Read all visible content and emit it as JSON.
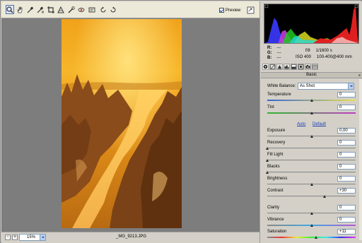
{
  "toolbar": {
    "tools": [
      "zoom-tool",
      "hand-tool",
      "white-balance-tool",
      "color-sampler-tool",
      "crop-tool",
      "straighten-tool",
      "retouch-tool",
      "red-eye-tool",
      "preferences-tool",
      "rotate-ccw-tool",
      "rotate-cw-tool"
    ],
    "preview_label": "Preview",
    "preview_checked": true
  },
  "status": {
    "zoom_minus": "-",
    "zoom_plus": "+",
    "zoom_value": "15%",
    "filename": "_MG_9213.JPG"
  },
  "rgb_readout": {
    "r_label": "R:",
    "r_value": "---",
    "g_label": "G:",
    "g_value": "---",
    "b_label": "B:",
    "b_value": "---"
  },
  "camera": {
    "aperture": "f/8",
    "shutter": "1/1600 s",
    "iso": "ISO 400",
    "lens": "100-400@400 mm"
  },
  "panel": {
    "section_title": "Basic",
    "menu_icon": "≡",
    "white_balance_label": "White Balance:",
    "white_balance_value": "As Shot",
    "auto_label": "Auto",
    "default_label": "Default"
  },
  "sliders": {
    "temperature": {
      "label": "Temperature",
      "value": "0",
      "position": 0.5
    },
    "tint": {
      "label": "Tint",
      "value": "0",
      "position": 0.5
    },
    "exposure": {
      "label": "Exposure",
      "value": "0,00",
      "position": 0.5
    },
    "recovery": {
      "label": "Recovery",
      "value": "0",
      "position": 0.0
    },
    "fill_light": {
      "label": "Fill Light",
      "value": "0",
      "position": 0.0
    },
    "blacks": {
      "label": "Blacks",
      "value": "0",
      "position": 0.0
    },
    "brightness": {
      "label": "Brightness",
      "value": "0",
      "position": 0.5
    },
    "contrast": {
      "label": "Contrast",
      "value": "+30",
      "position": 0.65
    },
    "clarity": {
      "label": "Clarity",
      "value": "0",
      "position": 0.5
    },
    "vibrance": {
      "label": "Vibrance",
      "value": "0",
      "position": 0.5
    },
    "saturation": {
      "label": "Saturation",
      "value": "+11",
      "position": 0.555
    }
  },
  "colors": {
    "accent": "#1a3fb0",
    "photo_sky": "#f2a51a",
    "photo_sun": "#ffd45a"
  }
}
